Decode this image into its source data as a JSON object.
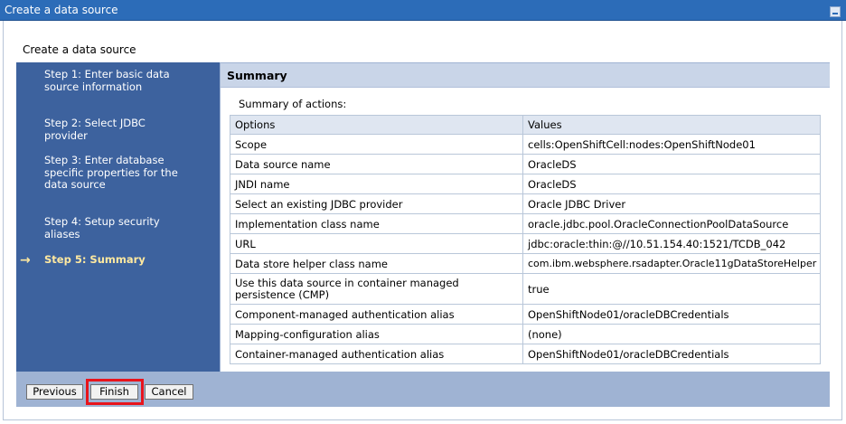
{
  "window": {
    "title": "Create a data source"
  },
  "page": {
    "heading": "Create a data source"
  },
  "steps": [
    {
      "label": "Step 1: Enter basic data source information"
    },
    {
      "label": "Step 2: Select JDBC provider"
    },
    {
      "label": "Step 3: Enter database specific properties for the data source"
    },
    {
      "label": "Step 4: Setup security aliases"
    },
    {
      "label": "Step 5: Summary",
      "current": true
    }
  ],
  "current_marker": "→",
  "summary": {
    "title": "Summary",
    "label": "Summary of actions:",
    "headers": [
      "Options",
      "Values"
    ],
    "rows": [
      [
        "Scope",
        "cells:OpenShiftCell:nodes:OpenShiftNode01"
      ],
      [
        "Data source name",
        "OracleDS"
      ],
      [
        "JNDI name",
        "OracleDS"
      ],
      [
        "Select an existing JDBC provider",
        "Oracle JDBC Driver"
      ],
      [
        "Implementation class name",
        "oracle.jdbc.pool.OracleConnectionPoolDataSource"
      ],
      [
        "URL",
        "jdbc:oracle:thin:@//10.51.154.40:1521/TCDB_042"
      ],
      [
        "Data store helper class name",
        "com.ibm.websphere.rsadapter.Oracle11gDataStoreHelper"
      ],
      [
        "Use this data source in container managed persistence (CMP)",
        "true"
      ],
      [
        "Component-managed authentication alias",
        "OpenShiftNode01/oracleDBCredentials"
      ],
      [
        "Mapping-configuration alias",
        "(none)"
      ],
      [
        "Container-managed authentication alias",
        "OpenShiftNode01/oracleDBCredentials"
      ]
    ]
  },
  "buttons": {
    "previous": "Previous",
    "finish": "Finish",
    "cancel": "Cancel"
  },
  "colors": {
    "titlebar": "#2c6cb8",
    "sidebar": "#3d629e",
    "highlight": "#e8141c"
  }
}
